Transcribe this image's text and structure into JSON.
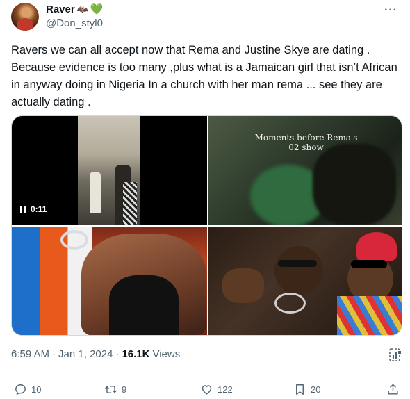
{
  "author": {
    "display_name": "Raver",
    "emoji_bat": "🦇",
    "emoji_heart": "💚",
    "handle": "@Don_styl0"
  },
  "tweet": {
    "text": "Ravers we can all accept now that Rema and Justine Skye are dating . Because evidence is too many ,plus what is a Jamaican girl that isn’t African in anyway doing in Nigeria In a church with her man rema ... see they are actually dating ."
  },
  "media": {
    "video_duration": "0:11",
    "caption_line1": "Moments before Rema's",
    "caption_line2": "02 show"
  },
  "meta": {
    "time": "6:59 AM",
    "separator": "·",
    "date": "Jan 1, 2024",
    "views_count": "16.1K",
    "views_label": "Views"
  },
  "actions": {
    "replies": "10",
    "retweets": "9",
    "likes": "122",
    "bookmarks": "20"
  }
}
